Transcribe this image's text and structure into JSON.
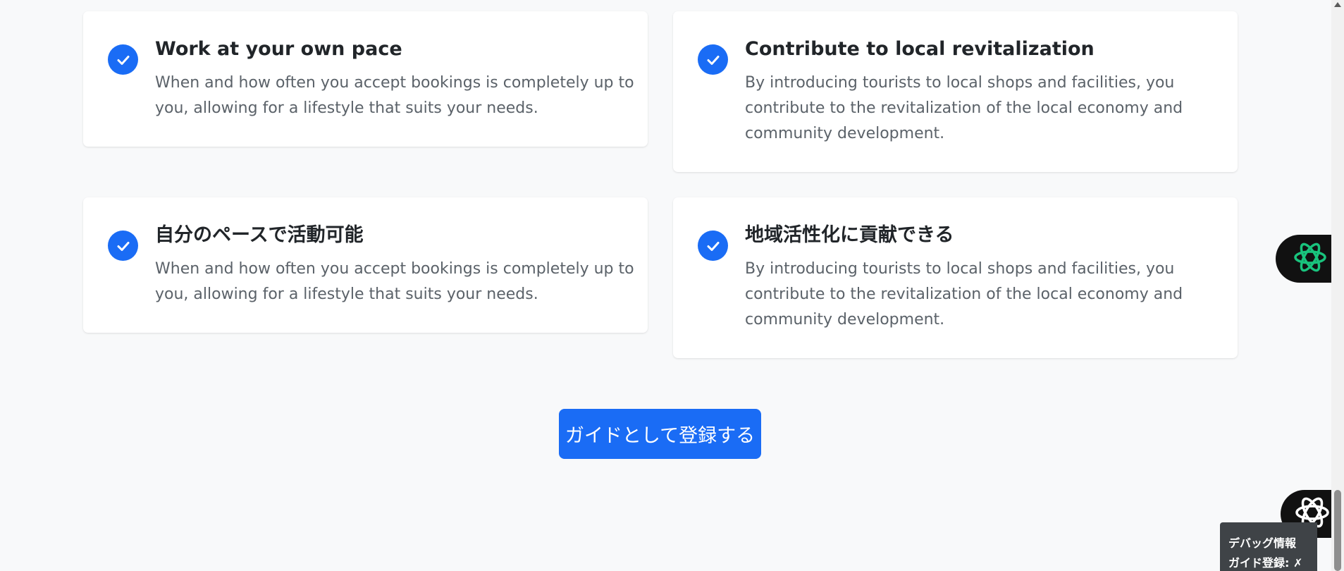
{
  "features": [
    {
      "title": "Work at your own pace",
      "lines": [
        "When and how often you accept bookings is completely up to",
        "you, allowing for a lifestyle that suits your needs."
      ]
    },
    {
      "title": "Contribute to local revitalization",
      "lines": [
        "By introducing tourists to local shops and facilities, you",
        "contribute to the revitalization of the local economy and",
        "community development."
      ]
    },
    {
      "title": "自分のペースで活動可能",
      "lines": [
        "When and how often you accept bookings is completely up to",
        "you, allowing for a lifestyle that suits your needs."
      ]
    },
    {
      "title": "地域活性化に貢献できる",
      "lines": [
        "By introducing tourists to local shops and facilities, you",
        "contribute to the revitalization of the local economy and",
        "community development."
      ]
    }
  ],
  "cta": {
    "label": "ガイドとして登録する"
  },
  "debug": {
    "title": "デバッグ情報",
    "status": "ガイド登録: ✗"
  },
  "icons": {
    "feature_check": "check-circle-icon",
    "floating_ai": "ai-assistant-icon",
    "floating_chat": "chat-assistant-icon"
  },
  "colors": {
    "accent": "#1a6cf5",
    "background": "#f8f9fa",
    "ai_icon": "#19c37d"
  }
}
